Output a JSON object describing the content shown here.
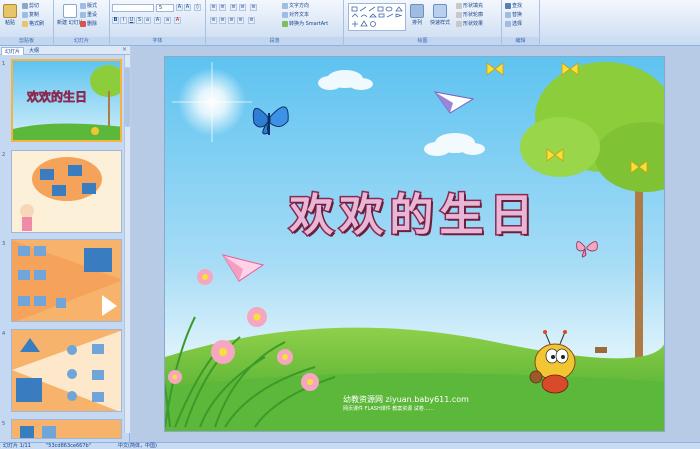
{
  "ribbon": {
    "clipboard": {
      "paste": "粘贴",
      "cut": "剪切",
      "copy": "复制",
      "format_painter": "格式刷",
      "label": "剪贴板"
    },
    "slides": {
      "new_slide": "新建\n幻灯片",
      "layout": "版式",
      "reset": "重设",
      "delete": "删除",
      "label": "幻灯片"
    },
    "font": {
      "size": "5",
      "label": "字体"
    },
    "paragraph": {
      "text_direction": "文字方向",
      "align_text": "对齐文本",
      "smartart": "转换为 SmartArt",
      "label": "段落"
    },
    "drawing": {
      "arrange": "排列",
      "quick_styles": "快速样式",
      "shape_fill": "形状填充",
      "shape_outline": "形状轮廓",
      "shape_effects": "形状效果",
      "label": "绘图"
    },
    "editing": {
      "find": "查找",
      "replace": "替换",
      "select": "选择",
      "label": "编辑"
    }
  },
  "panel": {
    "tab_slides": "幻灯片",
    "tab_outline": "大纲",
    "close": "×",
    "slide_numbers": [
      "1",
      "2",
      "3",
      "4",
      "5"
    ]
  },
  "slide": {
    "title": "欢欢的生日",
    "watermark": "幼教资源网 ziyuan.baby611.com",
    "watermark_sub": "网页课件 FLASH课件 教案资源 试卷……"
  },
  "status": {
    "slide_count": "幻灯片 1/11",
    "theme": "\"53cd863ce667b\"",
    "language": "中文(简体，中国)"
  },
  "colors": {
    "ribbon": "#dbe7f6",
    "panel": "#c5d8f1",
    "sky": "#5ec3f0",
    "grass": "#5cb83a",
    "title_fill": "#e8b6d6",
    "title_outline": "#8a2a52",
    "thumb_orange": "#f5a25a",
    "selection": "#f5b343"
  }
}
